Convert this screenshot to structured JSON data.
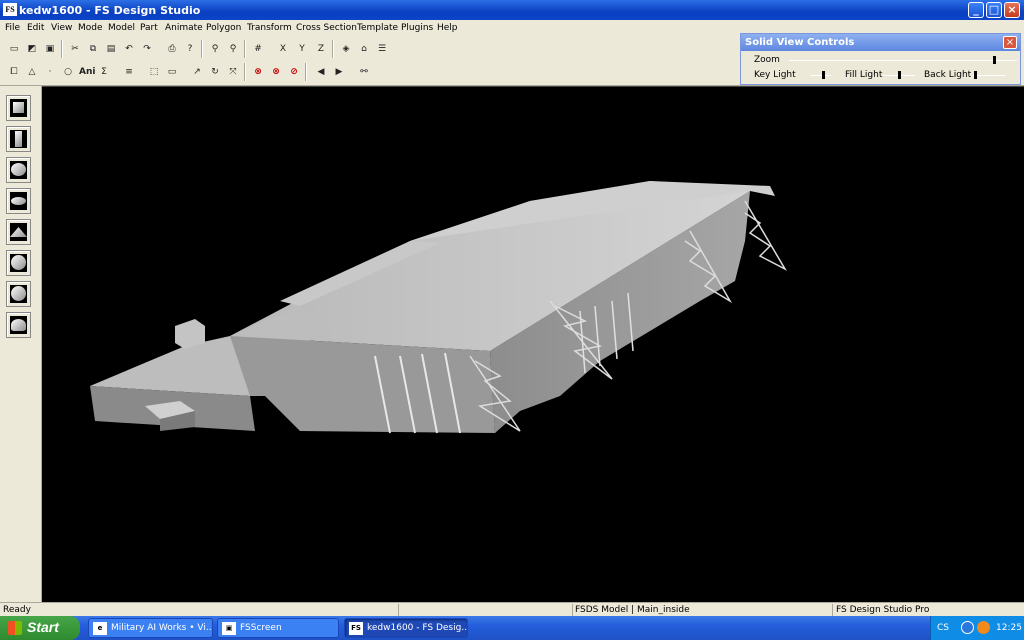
{
  "window": {
    "title": "kedw1600 - FS Design Studio",
    "app_icon": "FS"
  },
  "menu": [
    "File",
    "Edit",
    "View",
    "Mode",
    "Model",
    "Part",
    "Animate",
    "Polygon",
    "Transform",
    "Cross Section",
    "Template",
    "Plugins",
    "Help"
  ],
  "toolbar": {
    "ani_label": "Ani"
  },
  "solid_view_controls": {
    "title": "Solid View Controls",
    "zoom_label": "Zoom",
    "key_light_label": "Key Light",
    "fill_light_label": "Fill Light",
    "back_light_label": "Back Light",
    "zoom_value": 0.9,
    "key_light_value": 0.6,
    "fill_light_value": 0.5,
    "back_light_value": 0.05
  },
  "left_tools": [
    "cube-icon",
    "cylinder-icon",
    "sphere-icon",
    "disk-icon",
    "cone-icon",
    "geosphere-icon",
    "hemisphere-icon",
    "dome-icon"
  ],
  "status": {
    "ready": "Ready",
    "model": "FSDS Model | Main_inside",
    "product": "FS Design Studio Pro"
  },
  "taskbar": {
    "start_label": "Start",
    "tasks": [
      "Military AI Works • Vi...",
      "FSScreen",
      "kedw1600 - FS Desig..."
    ],
    "active_index": 2,
    "lang": "CS",
    "clock": "12:25"
  }
}
